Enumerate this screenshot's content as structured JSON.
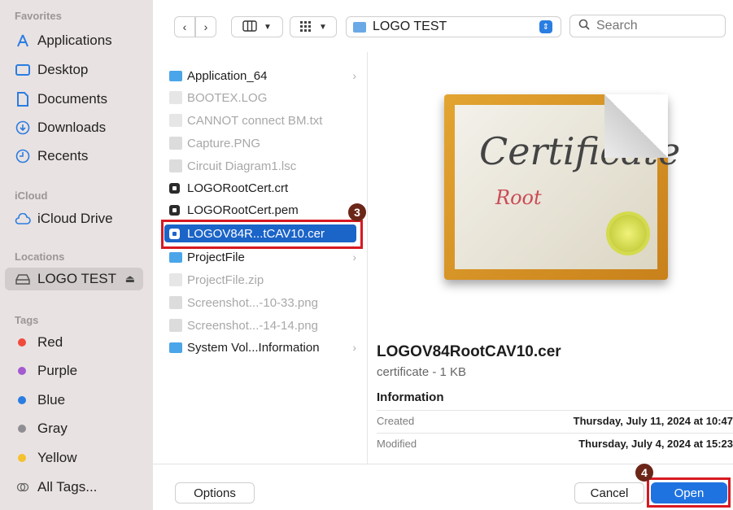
{
  "sidebar": {
    "favorites_label": "Favorites",
    "favorites": [
      {
        "label": "Applications",
        "icon": "applications-icon"
      },
      {
        "label": "Desktop",
        "icon": "desktop-icon"
      },
      {
        "label": "Documents",
        "icon": "document-icon"
      },
      {
        "label": "Downloads",
        "icon": "download-icon"
      },
      {
        "label": "Recents",
        "icon": "clock-icon"
      }
    ],
    "icloud_label": "iCloud",
    "icloud": [
      {
        "label": "iCloud Drive",
        "icon": "cloud-icon"
      }
    ],
    "locations_label": "Locations",
    "locations": [
      {
        "label": "LOGO TEST",
        "icon": "drive-icon",
        "eject": "⏏"
      }
    ],
    "tags_label": "Tags",
    "tags": [
      {
        "label": "Red",
        "color": "#f04a3d"
      },
      {
        "label": "Purple",
        "color": "#a35bd0"
      },
      {
        "label": "Blue",
        "color": "#2a7de1"
      },
      {
        "label": "Gray",
        "color": "#8e8e93"
      },
      {
        "label": "Yellow",
        "color": "#f5c12e"
      },
      {
        "label": "All Tags...",
        "color": "",
        "icon": "all-tags-icon"
      }
    ]
  },
  "toolbar": {
    "back": "‹",
    "forward": "›",
    "path": "LOGO TEST",
    "search_placeholder": "Search"
  },
  "files": [
    {
      "name": "Application_64",
      "type": "folder",
      "dim": false,
      "chevron": "›"
    },
    {
      "name": "BOOTEX.LOG",
      "type": "doc",
      "dim": true
    },
    {
      "name": "CANNOT connect BM.txt",
      "type": "doc",
      "dim": true
    },
    {
      "name": "Capture.PNG",
      "type": "img",
      "dim": true
    },
    {
      "name": "Circuit Diagram1.lsc",
      "type": "img",
      "dim": true
    },
    {
      "name": "LOGORootCert.crt",
      "type": "cert",
      "dim": false
    },
    {
      "name": "LOGORootCert.pem",
      "type": "cert",
      "dim": false
    },
    {
      "name": "LOGOV84R...tCAV10.cer",
      "type": "cert",
      "dim": false,
      "selected": true
    },
    {
      "name": "ProjectFile",
      "type": "folder",
      "dim": false,
      "chevron": "›"
    },
    {
      "name": "ProjectFile.zip",
      "type": "doc",
      "dim": true
    },
    {
      "name": "Screenshot...-10-33.png",
      "type": "img",
      "dim": true
    },
    {
      "name": "Screenshot...-14-14.png",
      "type": "img",
      "dim": true
    },
    {
      "name": "System Vol...Information",
      "type": "folder",
      "dim": false,
      "chevron": "›"
    }
  ],
  "markers": {
    "three": "3",
    "four": "4"
  },
  "preview": {
    "cert_title": "Certificate",
    "cert_subtitle": "Root",
    "name": "LOGOV84RootCAV10.cer",
    "kind": "certificate - 1 KB",
    "info_label": "Information",
    "created_label": "Created",
    "created_value": "Thursday, July 11, 2024 at 10:47",
    "modified_label": "Modified",
    "modified_value": "Thursday, July 4, 2024 at 15:23"
  },
  "buttons": {
    "options": "Options",
    "cancel": "Cancel",
    "open": "Open"
  }
}
